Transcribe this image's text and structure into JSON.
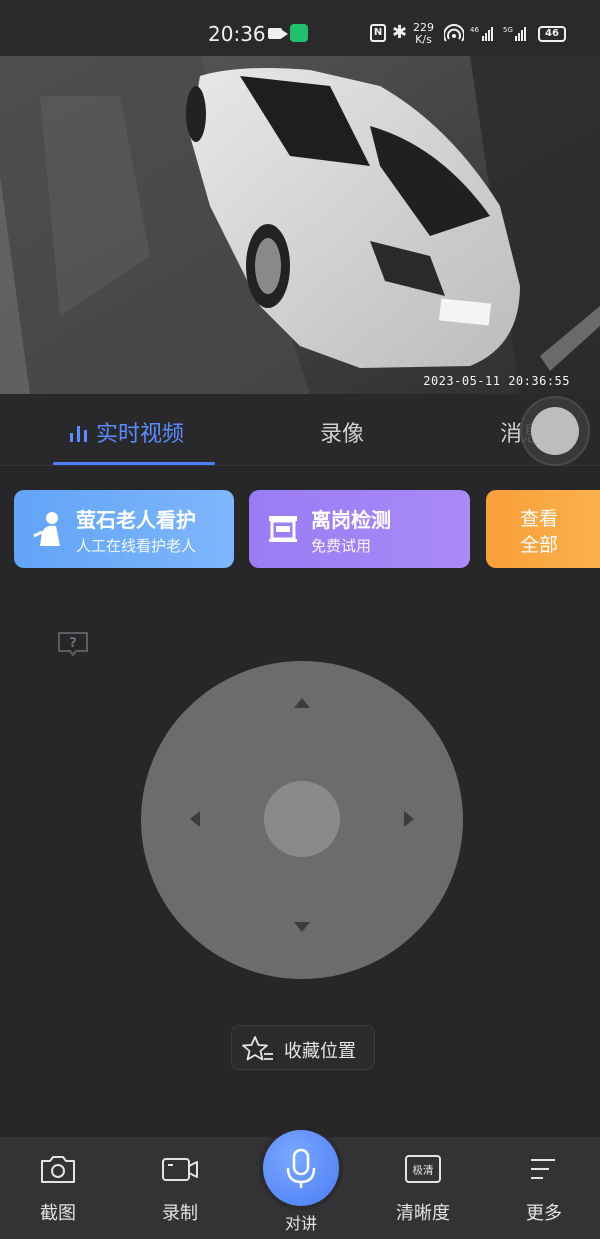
{
  "status_bar": {
    "time": "20:36",
    "nfc": "N",
    "speed_value": "229",
    "speed_unit": "K/s",
    "sig1": "46",
    "sig2": "5G",
    "battery": "46"
  },
  "video": {
    "timestamp": "2023-05-11 20:36:55"
  },
  "tabs": [
    {
      "label": "实时视频",
      "active": true
    },
    {
      "label": "录像",
      "active": false
    },
    {
      "label": "消息",
      "active": false
    }
  ],
  "cards": [
    {
      "title": "萤石老人看护",
      "subtitle": "人工在线看护老人",
      "icon": "elder-care-icon"
    },
    {
      "title": "离岗检测",
      "subtitle": "免费试用",
      "icon": "booth-icon"
    },
    {
      "line1": "查看",
      "line2": "全部"
    }
  ],
  "ptz": {
    "help_icon": "question-icon"
  },
  "favorite": {
    "label": "收藏位置",
    "icon": "star-list-icon"
  },
  "bottom_bar": {
    "items": [
      {
        "label": "截图",
        "icon": "camera-icon"
      },
      {
        "label": "录制",
        "icon": "video-record-icon"
      },
      {
        "label": "对讲",
        "icon": "mic-icon"
      },
      {
        "label": "清晰度",
        "icon": "quality-icon",
        "badge": "极清"
      },
      {
        "label": "更多",
        "icon": "menu-icon"
      }
    ]
  },
  "colors": {
    "accent": "#4f7dff",
    "background": "#272729",
    "card_blue": "#62a4f7",
    "card_purple": "#9a7cf5",
    "card_orange": "#f89f3a"
  }
}
